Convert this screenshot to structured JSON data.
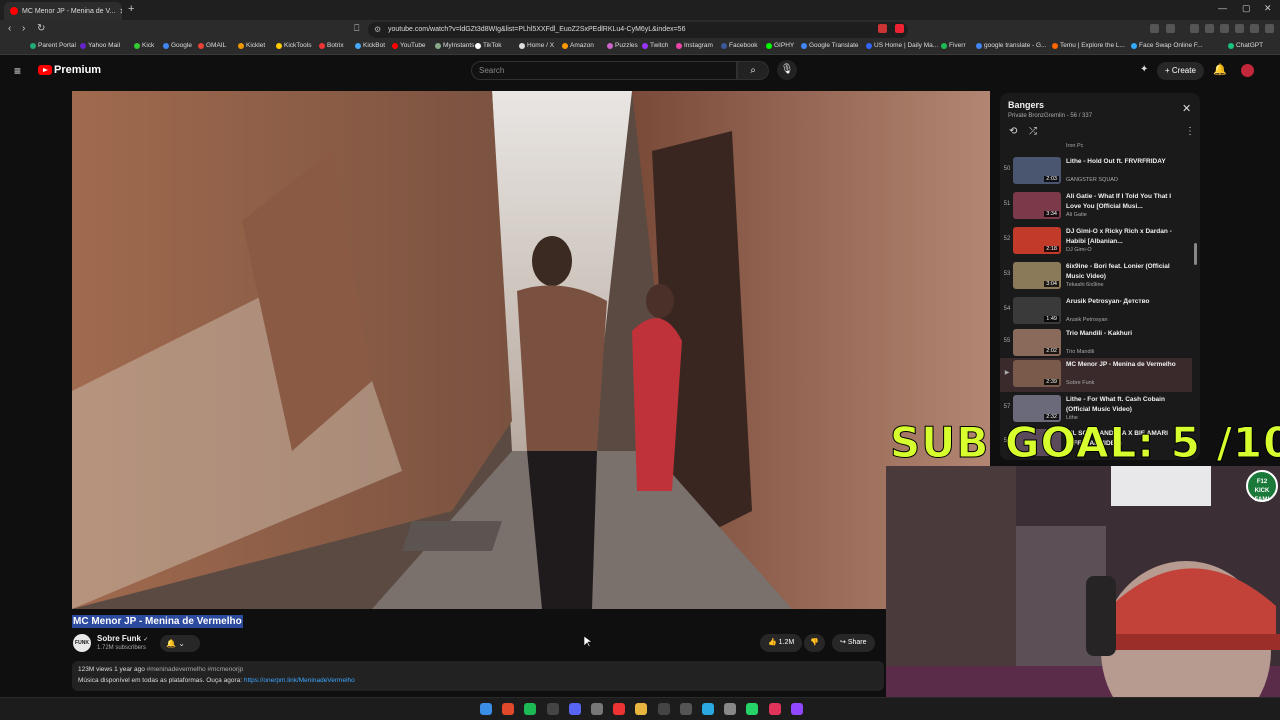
{
  "browser": {
    "tab_title": "MC Menor JP - Menina de V...",
    "url": "youtube.com/watch?v=ldGZt3d8WIg&list=PLhl5XXFdl_EuoZ2SxPEdlRKLu4-CyM6yL&index=56",
    "bookmarks": [
      "Parent Portal",
      "Yahoo Mail",
      "Kick",
      "Google",
      "GMAIL",
      "Kicklet",
      "KickTools",
      "Botrix",
      "KickBot",
      "YouTube",
      "MyInstants",
      "TikTok",
      "Home / X",
      "Amazon",
      "Puzzles",
      "Twitch",
      "Instagram",
      "Facebook",
      "GIPHY",
      "Google Translate",
      "US Home | Daily Ma...",
      "Fiverr",
      "google translate - G...",
      "Temu | Explore the L...",
      "Face Swap Online F...",
      "ChatGPT"
    ]
  },
  "youtube": {
    "logo_text": "Premium",
    "search_placeholder": "Search",
    "create_label": "Create"
  },
  "video": {
    "title": "MC Menor JP - Menina de Vermelho",
    "channel": "Sobre Funk",
    "avatar_text": "FUNK",
    "subscribers": "1.72M subscribers",
    "likes": "1.2M",
    "share_label": "Share",
    "views_age": "123M views  1 year ago",
    "hashtags": "#meninadevermelho #mcmenorjp",
    "description": "Música disponível em todas as plataformas. Ouça agora:",
    "link": "https://onerpm.link/MeninadeVermelho"
  },
  "playlist": {
    "title": "Bangers",
    "subtitle": "Private  BronzGremlin - 56 / 337",
    "prev_channel": "Iron Pc",
    "items": [
      {
        "index": "50",
        "title": "Lithe - Hold Out ft. FRVRFRIDAY",
        "channel": "GANGSTER SQUAD",
        "duration": "2:03",
        "color": "#4a5670"
      },
      {
        "index": "51",
        "title": "Ali Gatie - What If I Told You That I Love You [Official Musi...",
        "channel": "Ali Gatie",
        "duration": "3:34",
        "color": "#7a3a4a"
      },
      {
        "index": "52",
        "title": "DJ Gimi-O x Ricky Rich x Dardan - Habibi [Albanian...",
        "channel": "DJ Gimi-O",
        "duration": "2:18",
        "color": "#c23a2a"
      },
      {
        "index": "53",
        "title": "6ix9ine - Bori feat. Lonier (Official Music Video)",
        "channel": "Tekashi 6ix9ine",
        "duration": "3:04",
        "color": "#8a7a5a"
      },
      {
        "index": "54",
        "title": "Arusik Petrosyan- Детство",
        "channel": "Arusik Petrosyan",
        "duration": "1:49",
        "color": "#3a3a3a"
      },
      {
        "index": "55",
        "title": "Trio Mandili - Kakhuri",
        "channel": "Trio Mandili",
        "duration": "2:02",
        "color": "#8a6a5a"
      },
      {
        "index": "▶",
        "title": "MC Menor JP - Menina de Vermelho",
        "channel": "Sobre Funk",
        "duration": "2:39",
        "color": "#7a5a4a"
      },
      {
        "index": "57",
        "title": "Lithe - For What ft. Cash Cobain (Official Music Video)",
        "channel": "Lithe",
        "duration": "2:32",
        "color": "#6a6a7a"
      },
      {
        "index": "58",
        "title": "HIL SON MANDELA X BIE AMARI (OFFICIAL VIDEO)",
        "channel": "",
        "duration": "",
        "color": "#5a4a5a"
      }
    ]
  },
  "overlay": {
    "sub_goal": "SUB GOAL: 5 /10",
    "badge_line1": "F12",
    "badge_line2": "KICK FAM!"
  }
}
